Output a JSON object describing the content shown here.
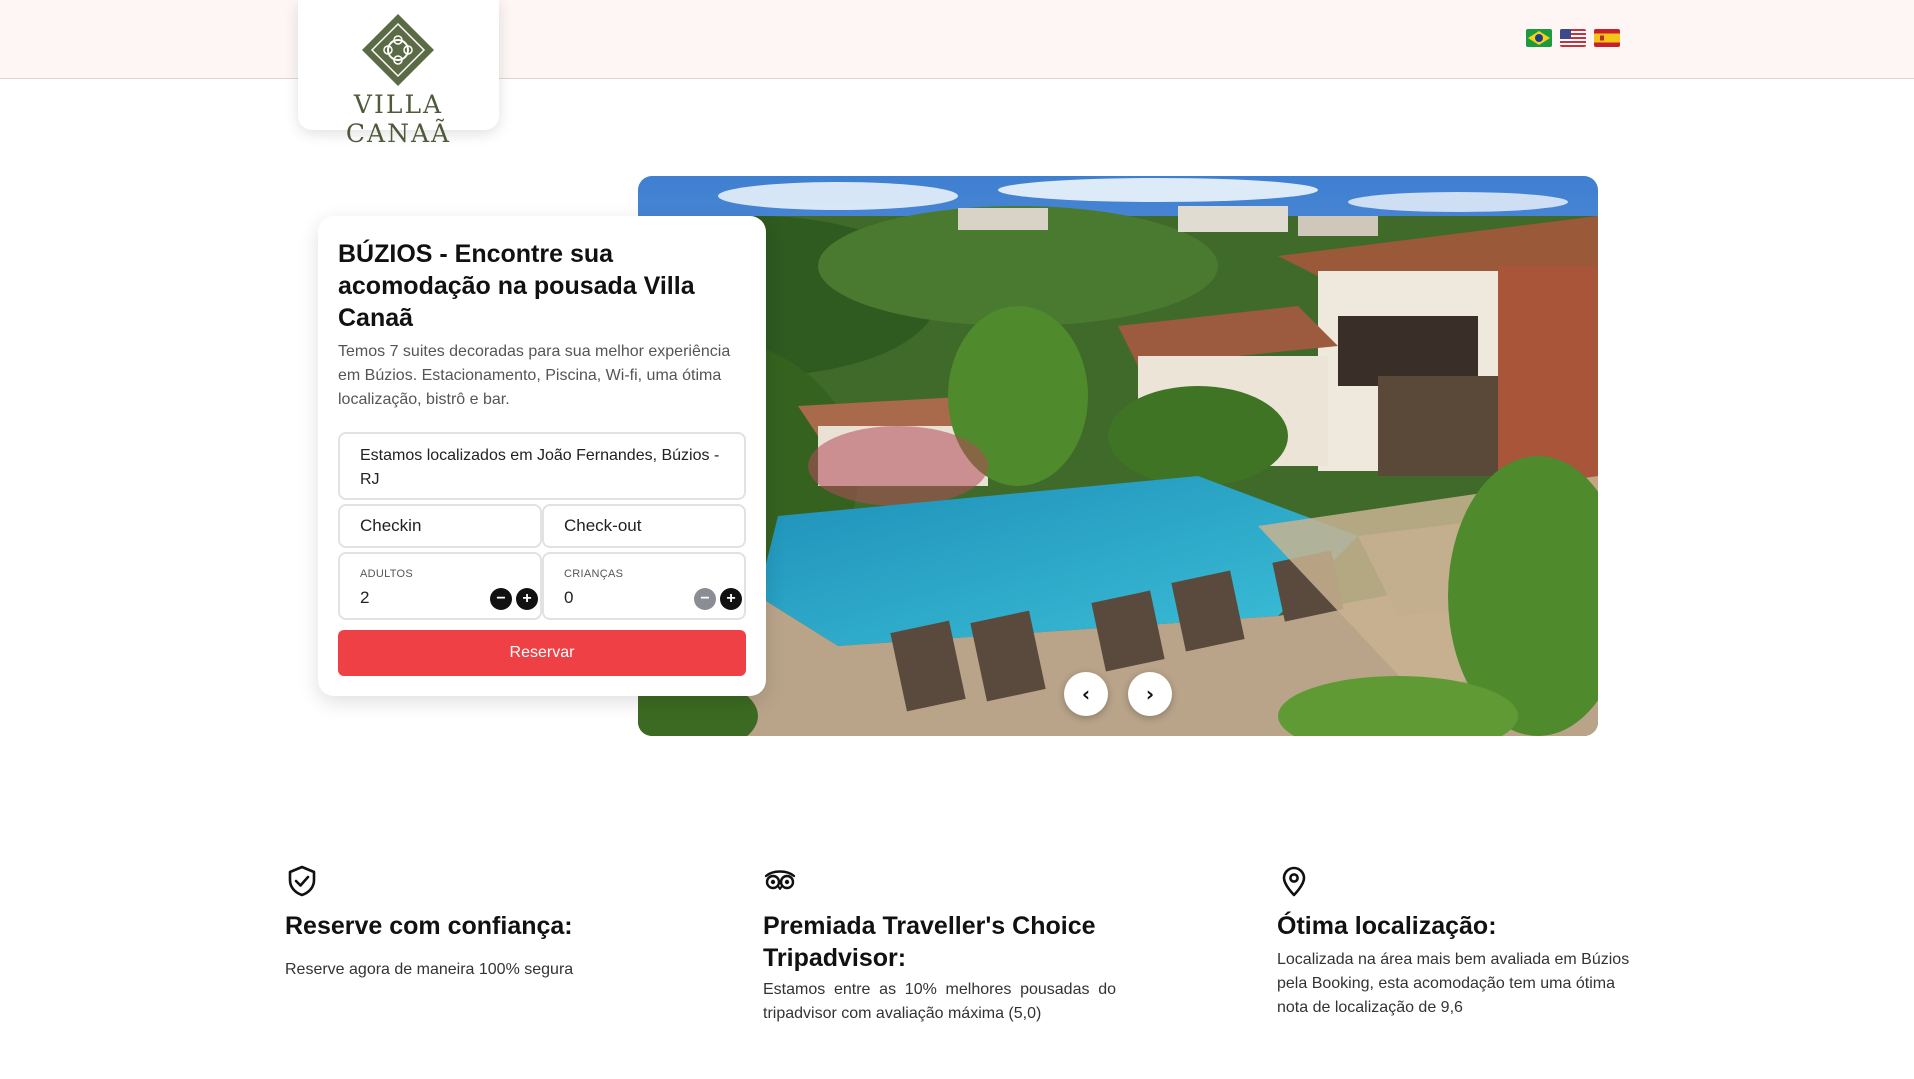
{
  "header": {
    "logo_text": "VILLA CANAÃ",
    "languages": [
      {
        "code": "pt-BR",
        "icon": "brazil-flag-icon"
      },
      {
        "code": "en-US",
        "icon": "usa-flag-icon"
      },
      {
        "code": "es",
        "icon": "spain-flag-icon"
      }
    ]
  },
  "booking": {
    "title": "BÚZIOS - Encontre sua acomodação na pousada Villa Canaã",
    "description": "Temos 7 suites decoradas para sua melhor experiência em Búzios. Estacionamento, Piscina, Wi-fi, uma ótima localização, bistrô e bar.",
    "location": "Estamos localizados em João Fernandes, Búzios - RJ",
    "checkin_placeholder": "Checkin",
    "checkout_placeholder": "Check-out",
    "adults": {
      "label": "ADULTOS",
      "value": "2"
    },
    "children": {
      "label": "CRIANÇAS",
      "value": "0"
    },
    "minus_glyph": "−",
    "plus_glyph": "+",
    "reserve_label": "Reservar"
  },
  "carousel": {
    "prev_glyph": "‹",
    "next_glyph": "›"
  },
  "features": [
    {
      "icon": "shield-check-icon",
      "title": "Reserve com confiança:",
      "text": "Reserve agora de maneira 100% segura"
    },
    {
      "icon": "tripadvisor-owl-icon",
      "title": "Premiada Traveller's Choice Tripadvisor:",
      "text": "Estamos entre as 10% melhores pousadas do tripadvisor com avaliação máxima (5,0)"
    },
    {
      "icon": "map-pin-icon",
      "title": "Ótima localização:",
      "text": "Localizada na área mais bem avaliada em Búzios pela Booking, esta acomodação tem uma ótima nota de localização de 9,6"
    }
  ],
  "colors": {
    "accent_red": "#ef4145",
    "header_bg": "#fdf6f4",
    "logo_green": "#5b6b45"
  }
}
